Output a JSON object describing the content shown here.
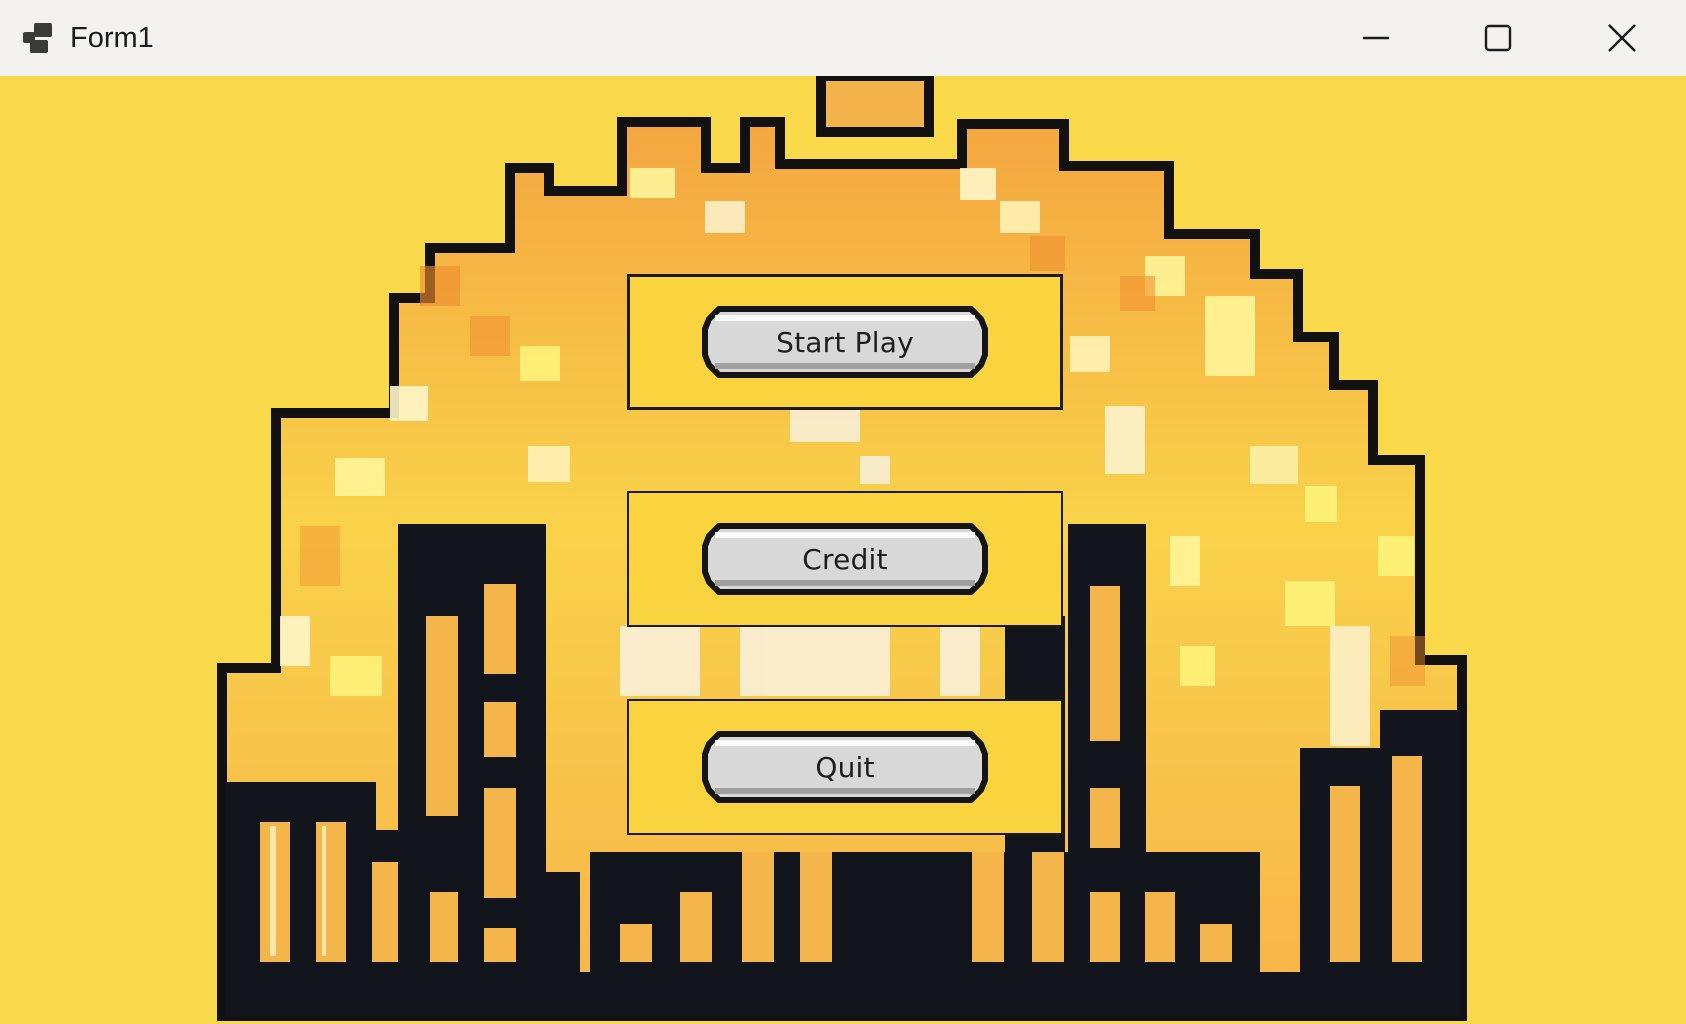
{
  "window": {
    "title": "Form1",
    "icons": {
      "app": "app-window-icon",
      "minimize": "minimize-icon",
      "maximize": "maximize-icon",
      "close": "close-icon"
    }
  },
  "background": {
    "color": "#f9d84a",
    "art": "pixel-art-city-skyline-with-glowing-dome"
  },
  "menu": {
    "start_label": "Start Play",
    "credit_label": "Credit",
    "quit_label": "Quit"
  },
  "colors": {
    "panel": "#f9d43f",
    "button_face": "#d8d8d8",
    "outline": "#1b1b1b"
  }
}
